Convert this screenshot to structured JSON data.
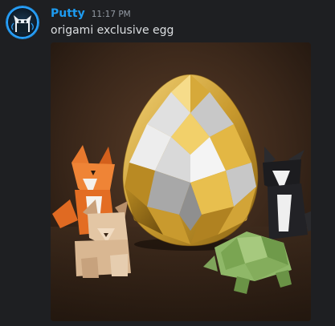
{
  "message": {
    "author": "Putty",
    "timestamp": "11:17 PM",
    "text": "origami exclusive egg"
  },
  "avatar": {
    "icon": "cat-avatar-icon"
  },
  "attachment": {
    "subjects": [
      "origami-egg",
      "origami-fox",
      "origami-dog",
      "origami-cat",
      "origami-turtle"
    ]
  },
  "colors": {
    "background": "#1e1f22",
    "username": "#1d9bf0",
    "timestamp": "#949ba4",
    "text": "#dbdee1",
    "avatar_ring": "#1f8fe0"
  }
}
